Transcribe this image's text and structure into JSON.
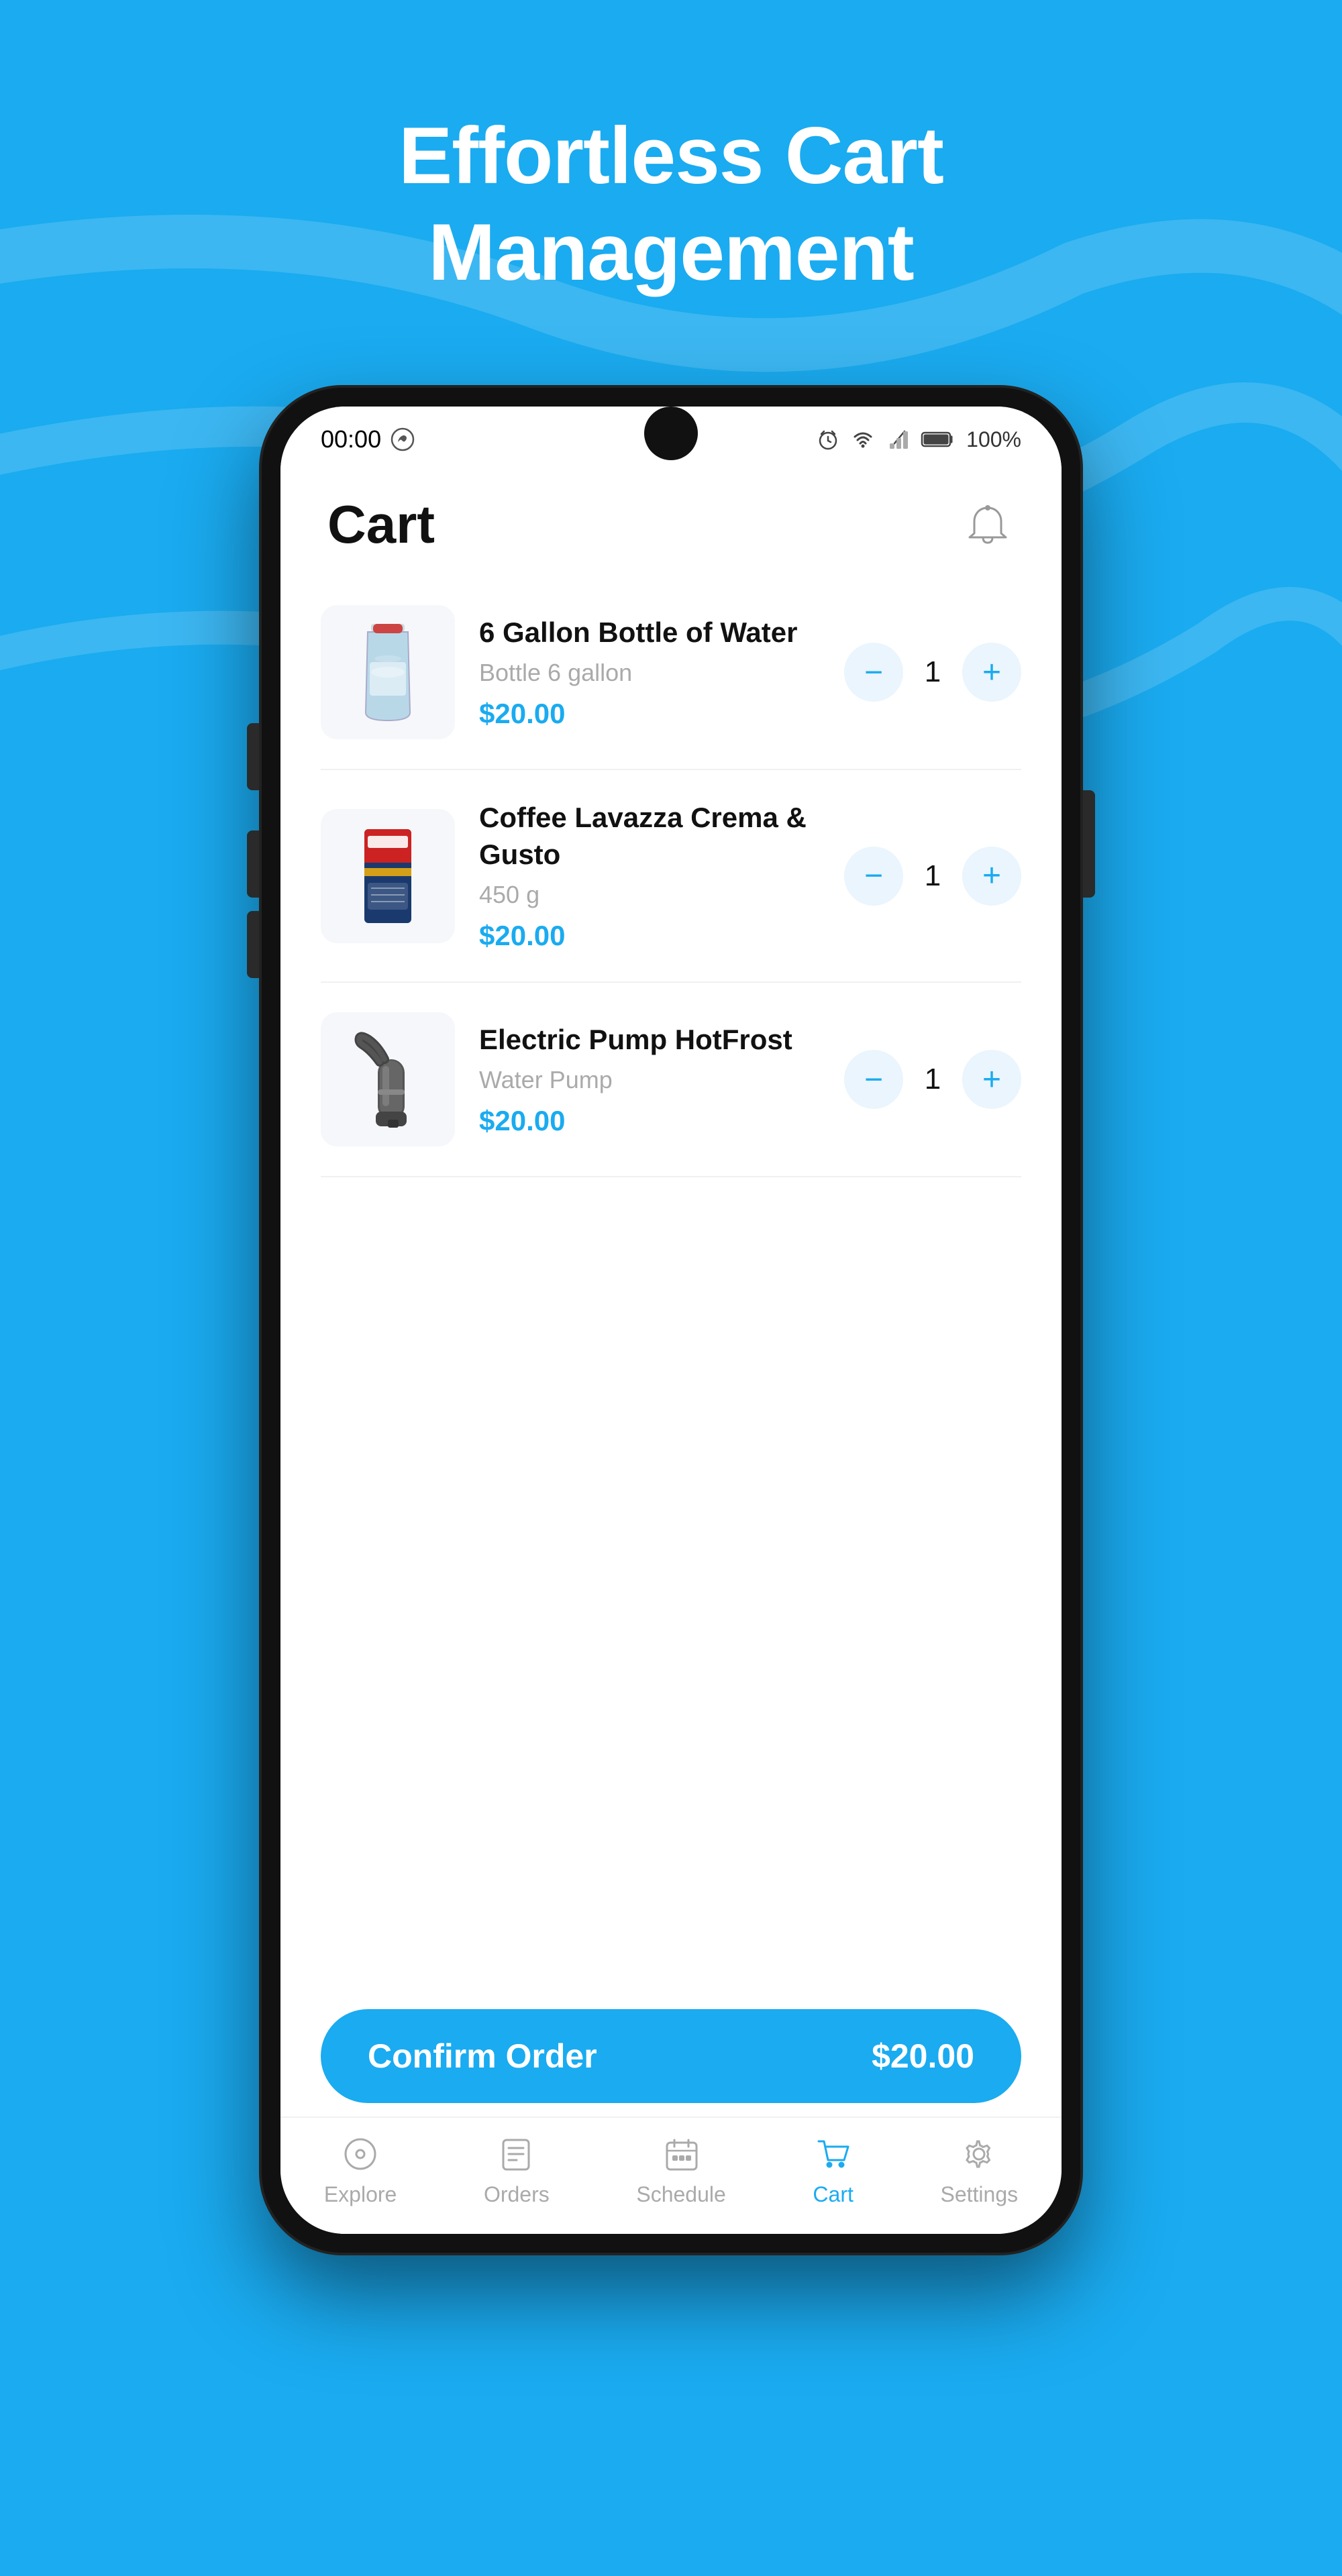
{
  "hero": {
    "title_line1": "Effortless Cart",
    "title_line2": "Management"
  },
  "phone": {
    "status_bar": {
      "time": "00:00",
      "battery": "100%"
    },
    "header": {
      "title": "Cart"
    },
    "cart_items": [
      {
        "id": "item-1",
        "name": "6 Gallon Bottle of Water",
        "subtitle": "Bottle 6 gallon",
        "price": "$20.00",
        "quantity": 1
      },
      {
        "id": "item-2",
        "name": "Coffee Lavazza Crema & Gusto",
        "subtitle": "450 g",
        "price": "$20.00",
        "quantity": 1
      },
      {
        "id": "item-3",
        "name": "Electric Pump HotFrost",
        "subtitle": "Water Pump",
        "price": "$20.00",
        "quantity": 1
      }
    ],
    "confirm_button": {
      "label": "Confirm Order",
      "price": "$20.00"
    },
    "nav_tabs": [
      {
        "label": "Explore",
        "active": false
      },
      {
        "label": "Orders",
        "active": false
      },
      {
        "label": "Schedule",
        "active": false
      },
      {
        "label": "Cart",
        "active": true
      },
      {
        "label": "Settings",
        "active": false
      }
    ]
  }
}
